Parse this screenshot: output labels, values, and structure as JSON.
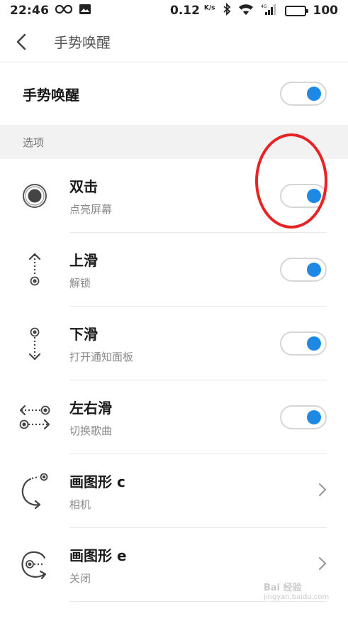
{
  "status_bar": {
    "time": "22:46",
    "speed": "0.12",
    "speed_unit": "K/s",
    "battery": "100"
  },
  "header": {
    "title": "手势唤醒"
  },
  "master": {
    "label": "手势唤醒",
    "enabled": true
  },
  "section": {
    "title": "选项"
  },
  "gestures": [
    {
      "title": "双击",
      "subtitle": "点亮屏幕",
      "icon": "double-tap-icon",
      "control": "toggle",
      "enabled": true
    },
    {
      "title": "上滑",
      "subtitle": "解锁",
      "icon": "swipe-up-icon",
      "control": "toggle",
      "enabled": true
    },
    {
      "title": "下滑",
      "subtitle": "打开通知面板",
      "icon": "swipe-down-icon",
      "control": "toggle",
      "enabled": true
    },
    {
      "title": "左右滑",
      "subtitle": "切换歌曲",
      "icon": "swipe-left-right-icon",
      "control": "toggle",
      "enabled": true
    },
    {
      "title": "画图形 c",
      "subtitle": "相机",
      "icon": "draw-c-icon",
      "control": "chevron"
    },
    {
      "title": "画图形 e",
      "subtitle": "关闭",
      "icon": "draw-e-icon",
      "control": "chevron"
    }
  ],
  "colors": {
    "accent": "#1e88e5",
    "annotation": "#e82323"
  },
  "watermark": {
    "text": "Bai 经验",
    "url": "jingyan.baidu.com"
  }
}
